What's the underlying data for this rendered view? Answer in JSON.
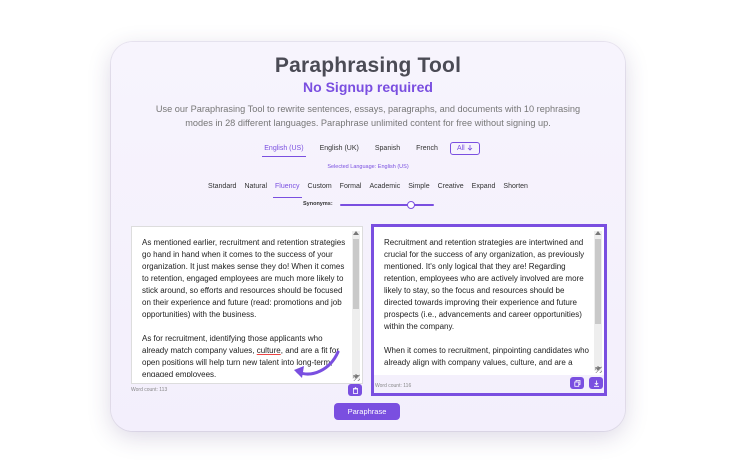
{
  "header": {
    "title": "Paraphrasing Tool",
    "subtitle": "No Signup required",
    "description": "Use our Paraphrasing Tool to rewrite sentences, essays, paragraphs, and documents with 10 rephrasing modes in 28 different languages. Paraphrase unlimited content for free without signing up."
  },
  "languages": {
    "items": [
      "English (US)",
      "English (UK)",
      "Spanish",
      "French"
    ],
    "active_index": 0,
    "all_label": "All",
    "selected_text": "Selected Language: English (US)"
  },
  "modes": {
    "items": [
      "Standard",
      "Natural",
      "Fluency",
      "Custom",
      "Formal",
      "Academic",
      "Simple",
      "Creative",
      "Expand",
      "Shorten"
    ],
    "active_index": 2
  },
  "synonyms": {
    "label": "Synonyms:",
    "level": 0.75
  },
  "input": {
    "paragraph1": "As mentioned earlier, recruitment and retention strategies go hand in hand when it comes to the success of your organization. It just makes sense they do! When it comes to retention, engaged employees are much more likely to stick around, so efforts and resources should be focused on their experience and future (read: promotions and job opportunities) with the business.",
    "paragraph2_a": "As for recruitment, identifying those applicants who already match company values, ",
    "paragraph2_underlined": "culture",
    "paragraph2_b": ", and are a fit for open positions will help turn new talent into long-term, engaged employees.",
    "word_count": "Word count: 113"
  },
  "output": {
    "paragraph1": "Recruitment and retention strategies are intertwined and crucial for the success of any organization, as previously mentioned. It's only logical that they are! Regarding retention, employees who are actively involved are more likely to stay, so the focus and resources should be directed towards improving their experience and future prospects (i.e., advancements and career opportunities) within the company.",
    "paragraph2": "When it comes to recruitment, pinpointing candidates who already align with company values, culture, and are a good match for available positions will facilitate the transformation of new talent into enduring,",
    "word_count": "Word count: 116"
  },
  "actions": {
    "paraphrase_label": "Paraphrase"
  },
  "colors": {
    "accent": "#7a4fe0",
    "title": "#4b4b55"
  }
}
